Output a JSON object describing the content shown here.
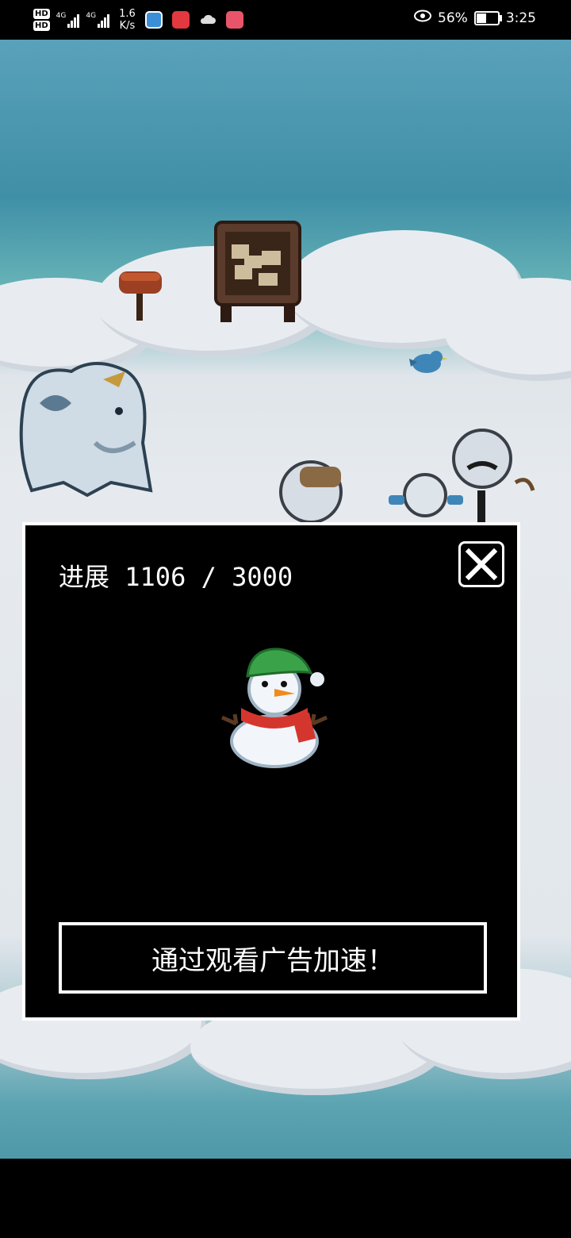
{
  "status_bar": {
    "hd1": "HD",
    "hd2": "HD",
    "net1": "4G",
    "net2": "4G",
    "speed_value": "1.6",
    "speed_unit": "K/s",
    "battery_percent": "56%",
    "battery_level": 0.56,
    "time": "3:25",
    "icons": [
      "browser-icon",
      "huawei-store-icon",
      "cloud-icon",
      "book-icon",
      "eye-icon"
    ]
  },
  "dialog": {
    "progress_label": "进展 1106 / 3000",
    "progress_current": 1106,
    "progress_total": 3000,
    "ad_button_label": "通过观看广告加速！"
  },
  "colors": {
    "sky": "#3f8fa7",
    "cloud": "#e6eaee",
    "dialog_bg": "#000000",
    "dialog_border": "#ffffff"
  }
}
